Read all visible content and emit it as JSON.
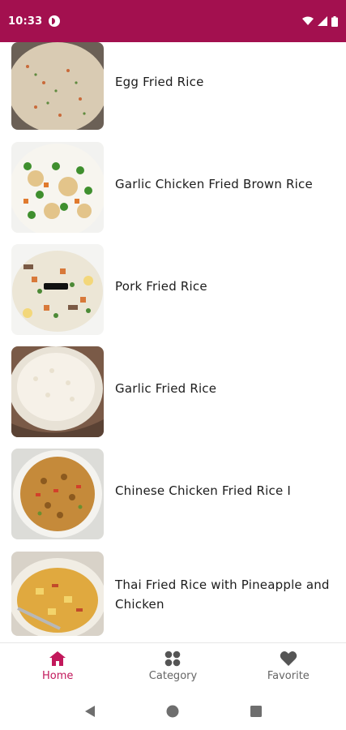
{
  "status_bar": {
    "time": "10:33",
    "color": "#a3104f",
    "icons": [
      "app-notification-icon",
      "wifi-icon",
      "cellular-icon",
      "battery-icon"
    ]
  },
  "recipes": [
    {
      "title": "Egg Fried Rice"
    },
    {
      "title": "Garlic Chicken Fried Brown Rice"
    },
    {
      "title": "Pork Fried Rice"
    },
    {
      "title": "Garlic Fried Rice"
    },
    {
      "title": "Chinese Chicken Fried Rice I"
    },
    {
      "title": "Thai Fried Rice with Pineapple and Chicken"
    }
  ],
  "bottom_nav": {
    "active_color": "#c2185b",
    "items": [
      {
        "label": "Home",
        "icon": "home-icon",
        "active": true
      },
      {
        "label": "Category",
        "icon": "grid-icon",
        "active": false
      },
      {
        "label": "Favorite",
        "icon": "heart-icon",
        "active": false
      }
    ]
  },
  "system_nav": [
    "back-icon",
    "home-circle-icon",
    "recents-icon"
  ]
}
